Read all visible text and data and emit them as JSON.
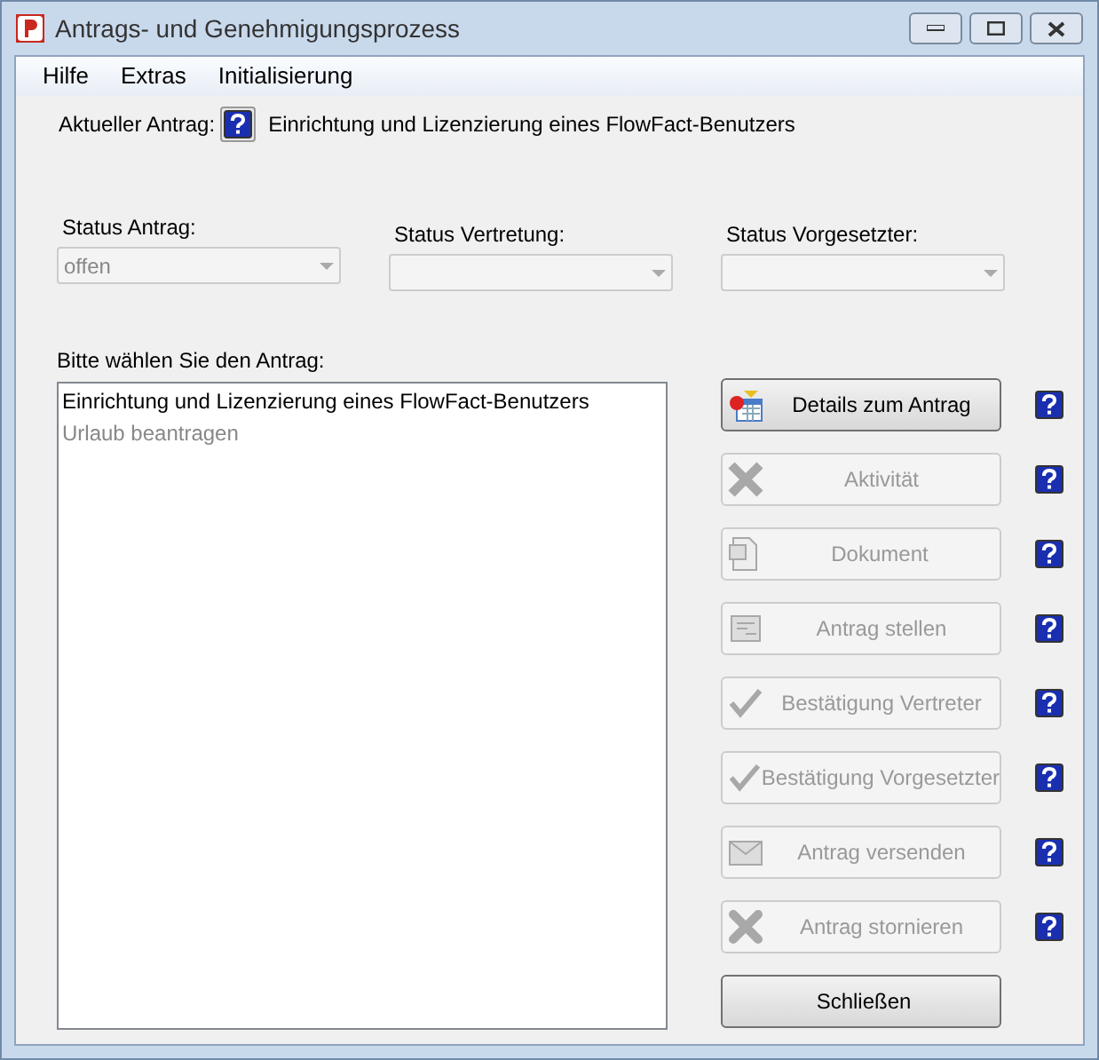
{
  "window": {
    "title": "Antrags- und Genehmigungsprozess"
  },
  "menu": [
    "Hilfe",
    "Extras",
    "Initialisierung"
  ],
  "current": {
    "label": "Aktueller Antrag:",
    "value": "Einrichtung und Lizenzierung eines FlowFact-Benutzers"
  },
  "statuses": [
    {
      "label": "Status Antrag:",
      "value": "offen",
      "disabled": true
    },
    {
      "label": "Status Vertretung:",
      "disabled": true
    },
    {
      "label": "Status Vorgesetzter:",
      "disabled": true
    }
  ],
  "list": {
    "label": "Bitte wählen Sie den Antrag:",
    "items": [
      {
        "text": "Einrichtung und Lizenzierung eines FlowFact-Benutzers",
        "disabled": false
      },
      {
        "text": "Urlaub beantragen",
        "disabled": true
      }
    ]
  },
  "actions": [
    {
      "kind": "details",
      "label": "Details zum Antrag",
      "disabled": false,
      "help": true
    },
    {
      "kind": "activity",
      "label": "Aktivität",
      "disabled": true,
      "help": true
    },
    {
      "kind": "document",
      "label": "Dokument",
      "disabled": true,
      "help": true
    },
    {
      "kind": "form",
      "label": "Antrag stellen",
      "disabled": true,
      "help": true
    },
    {
      "kind": "check",
      "label": "Bestätigung Vertreter",
      "disabled": true,
      "help": true
    },
    {
      "kind": "check",
      "label": "Bestätigung Vorgesetzter",
      "disabled": true,
      "help": true
    },
    {
      "kind": "mail",
      "label": "Antrag versenden",
      "disabled": true,
      "help": true
    },
    {
      "kind": "cancel",
      "label": "Antrag stornieren",
      "disabled": true,
      "help": true
    },
    {
      "kind": "plain",
      "label": "Schließen",
      "disabled": false,
      "help": false
    }
  ]
}
